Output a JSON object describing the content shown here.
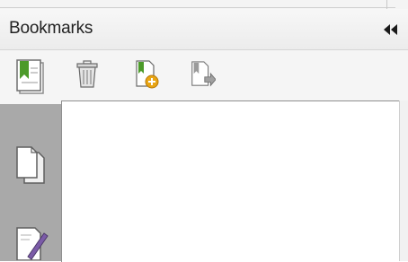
{
  "panel": {
    "title": "Bookmarks",
    "collapse_icon": "double-chevron-left-icon"
  },
  "toolbar": {
    "buttons": [
      {
        "name": "delete-bookmark-button",
        "icon": "trash-icon"
      },
      {
        "name": "new-bookmark-button",
        "icon": "new-bookmark-icon"
      },
      {
        "name": "move-bookmark-button",
        "icon": "bookmark-arrow-icon"
      }
    ]
  },
  "sidebar": {
    "tabs": [
      {
        "name": "tab-bookmarks",
        "icon": "bookmark-panel-icon",
        "active": true
      },
      {
        "name": "tab-pages",
        "icon": "pages-icon",
        "active": false
      },
      {
        "name": "tab-signatures",
        "icon": "signature-pen-icon",
        "active": false
      }
    ]
  },
  "colors": {
    "sidebar_bg": "#a9a9a9",
    "toolbar_bg": "#f5f5f5",
    "bookmark_green": "#4c9a2a",
    "add_yellow": "#e8a514"
  }
}
